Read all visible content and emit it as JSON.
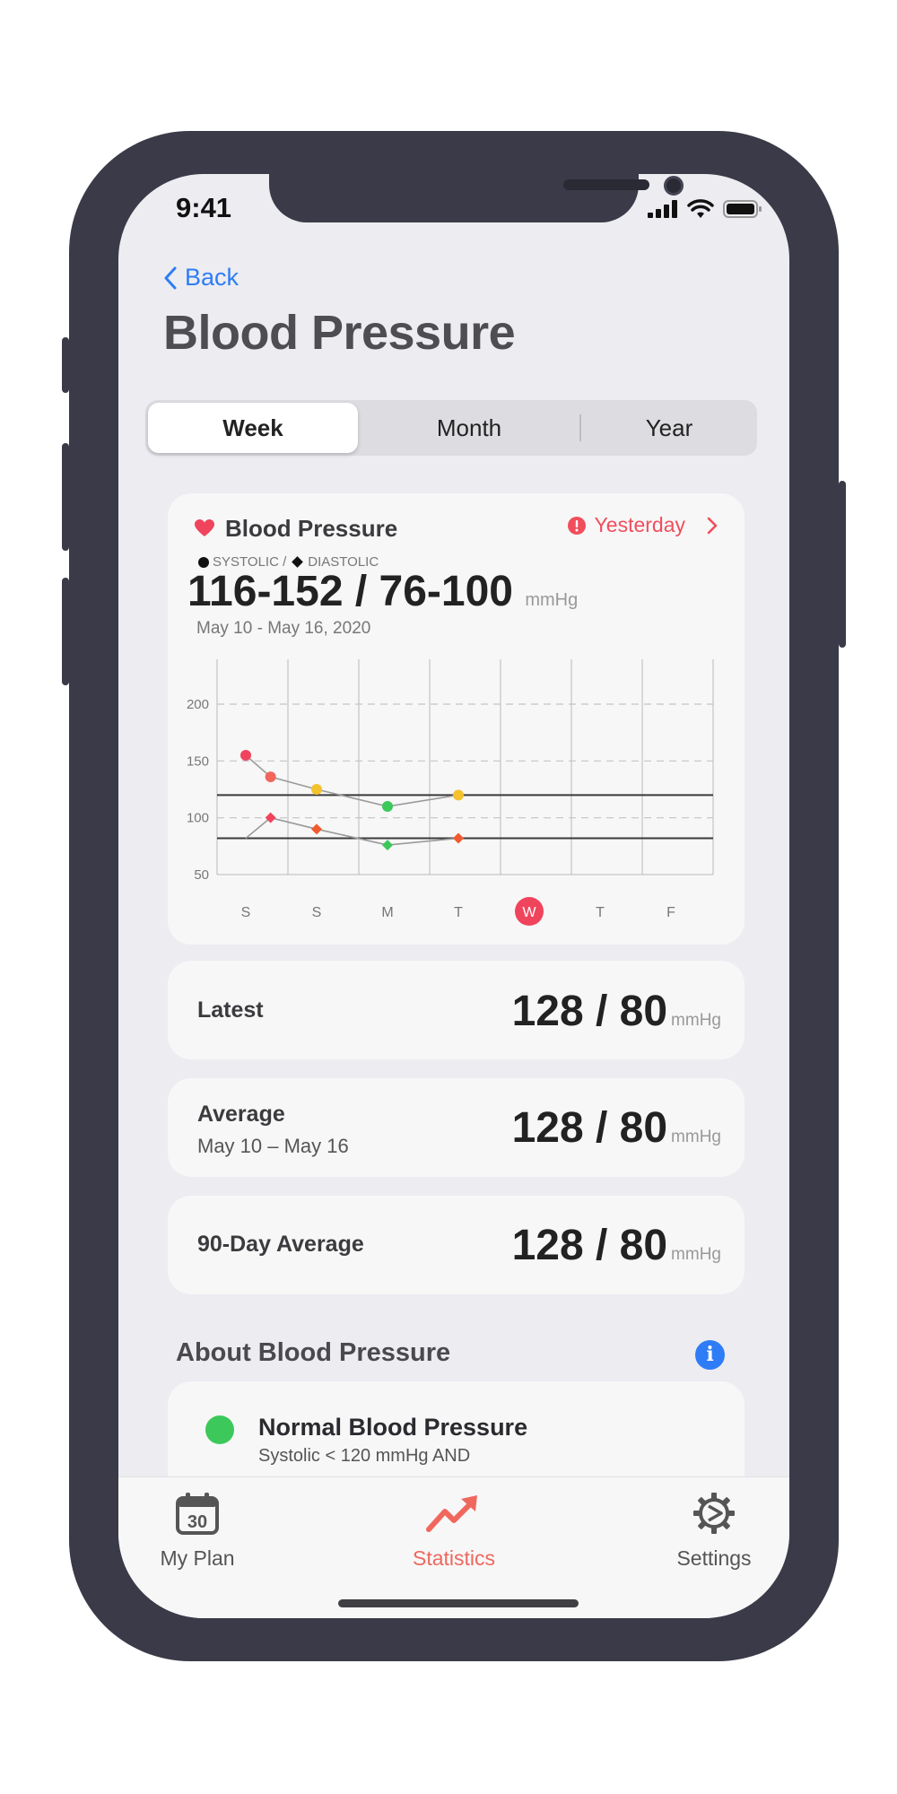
{
  "status_bar": {
    "time": "9:41"
  },
  "nav": {
    "back_label": "Back",
    "title": "Blood Pressure"
  },
  "segments": {
    "items": [
      "Week",
      "Month",
      "Year"
    ],
    "selected": "Week"
  },
  "chart_card": {
    "title": "Blood Pressure",
    "alert_label": "Yesterday",
    "legend_systolic": "SYSTOLIC /",
    "legend_diastolic": "DIASTOLIC",
    "range_value": "116-152 / 76-100",
    "range_unit": "mmHg",
    "date_range": "May 10 - May 16, 2020"
  },
  "chart_data": {
    "type": "line",
    "categories": [
      "S",
      "S",
      "M",
      "T",
      "W",
      "T",
      "F"
    ],
    "highlighted_category_index": 4,
    "ylim": [
      50,
      200
    ],
    "yticks": [
      50,
      100,
      150,
      200
    ],
    "dashed_gridlines": [
      100,
      150,
      200
    ],
    "reference_lines": [
      120,
      82
    ],
    "x_positions": [
      0,
      0.35,
      1,
      2,
      3
    ],
    "series": [
      {
        "values": [
          155,
          136,
          125,
          110,
          120
        ],
        "colors": [
          "#f0445c",
          "#f0665c",
          "#f4c22e",
          "#3cc85a",
          "#f4c22e"
        ],
        "marker": "circle"
      },
      {
        "values": [
          82,
          100,
          90,
          76,
          82
        ],
        "colors": [
          "#8a8a8a",
          "#f0445c",
          "#f05a2e",
          "#3cc85a",
          "#f05a2e"
        ],
        "marker": "diamond"
      }
    ]
  },
  "stats": [
    {
      "label": "Latest",
      "sub": "",
      "value": "128 / 80",
      "unit": "mmHg"
    },
    {
      "label": "Average",
      "sub": "May 10 – May 16",
      "value": "128 / 80",
      "unit": "mmHg"
    },
    {
      "label": "90-Day Average",
      "sub": "",
      "value": "128 / 80",
      "unit": "mmHg"
    }
  ],
  "about": {
    "title": "About Blood Pressure",
    "info_icon": "i",
    "normal_title": "Normal Blood Pressure",
    "normal_sub": "Systolic < 120 mmHg AND"
  },
  "tabbar": {
    "items": [
      {
        "label": "My Plan",
        "icon": "calendar-icon",
        "calendar_day": "30"
      },
      {
        "label": "Statistics",
        "icon": "trend-up-icon"
      },
      {
        "label": "Settings",
        "icon": "gear-icon"
      }
    ],
    "active_color": "#f0675e"
  },
  "colors": {
    "accent_blue": "#2e7df6",
    "alert_red": "#f04e5c",
    "frame": "#3a3a48"
  }
}
